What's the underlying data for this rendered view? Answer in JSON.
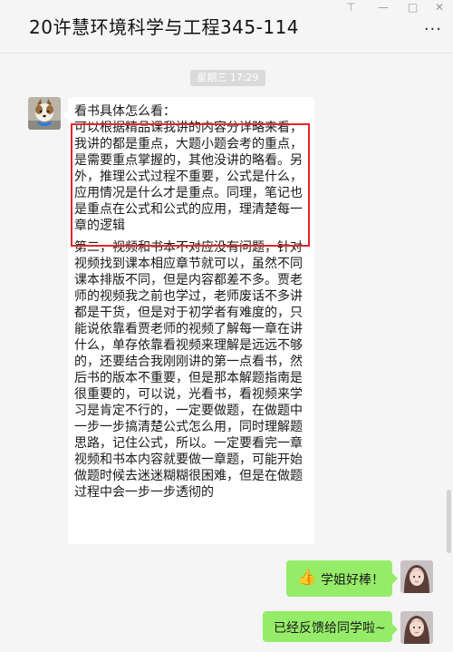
{
  "window": {
    "title": "20许慧环境科学与工程345-114",
    "pin_icon": "⊤",
    "minimize_icon": "—",
    "maximize_icon": "□",
    "close_icon": "✕",
    "more_icon": "···"
  },
  "timestamp": "星期三 17:29",
  "messages": [
    {
      "side": "left",
      "heading": "看书具体怎么看：",
      "highlighted": "可以根据精品课我讲的内容分详略来看，我讲的都是重点，大题小题会考的重点，是需要重点掌握的，其他没讲的略看。另外，推理公式过程不重要，公式是什么，应用情况是什么才是重点。同理，笔记也是重点在公式和公式的应用，理清楚每一章的逻辑",
      "rest": "第二，视频和书本不对应没有问题，针对视频找到课本相应章节就可以，虽然不同课本排版不同，但是内容都差不多。贾老师的视频我之前也学过，老师废话不多讲都是干货，但是对于初学者有难度的，只能说依靠看贾老师的视频了解每一章在讲什么，单存依靠看视频来理解是远远不够的，还要结合我刚刚讲的第一点看书，然后书的版本不重要，但是那本解题指南是很重要的，可以说，光看书，看视频来学习是肯定不行的，一定要做题，在做题中一步一步搞清楚公式怎么用，同时理解题思路，记住公式，所以。一定要看完一章视频和书本内容就要做一章题，可能开始做题时候去迷迷糊糊很困难，但是在做题过程中会一步一步透彻的"
    },
    {
      "side": "right",
      "emoji": "👍",
      "text": "学姐好棒！"
    },
    {
      "side": "right",
      "text": "已经反馈给同学啦~"
    }
  ],
  "colors": {
    "background": "#f5f5f5",
    "bubble_left": "#ffffff",
    "bubble_right": "#95ec69",
    "highlight_border": "#e2262a"
  }
}
